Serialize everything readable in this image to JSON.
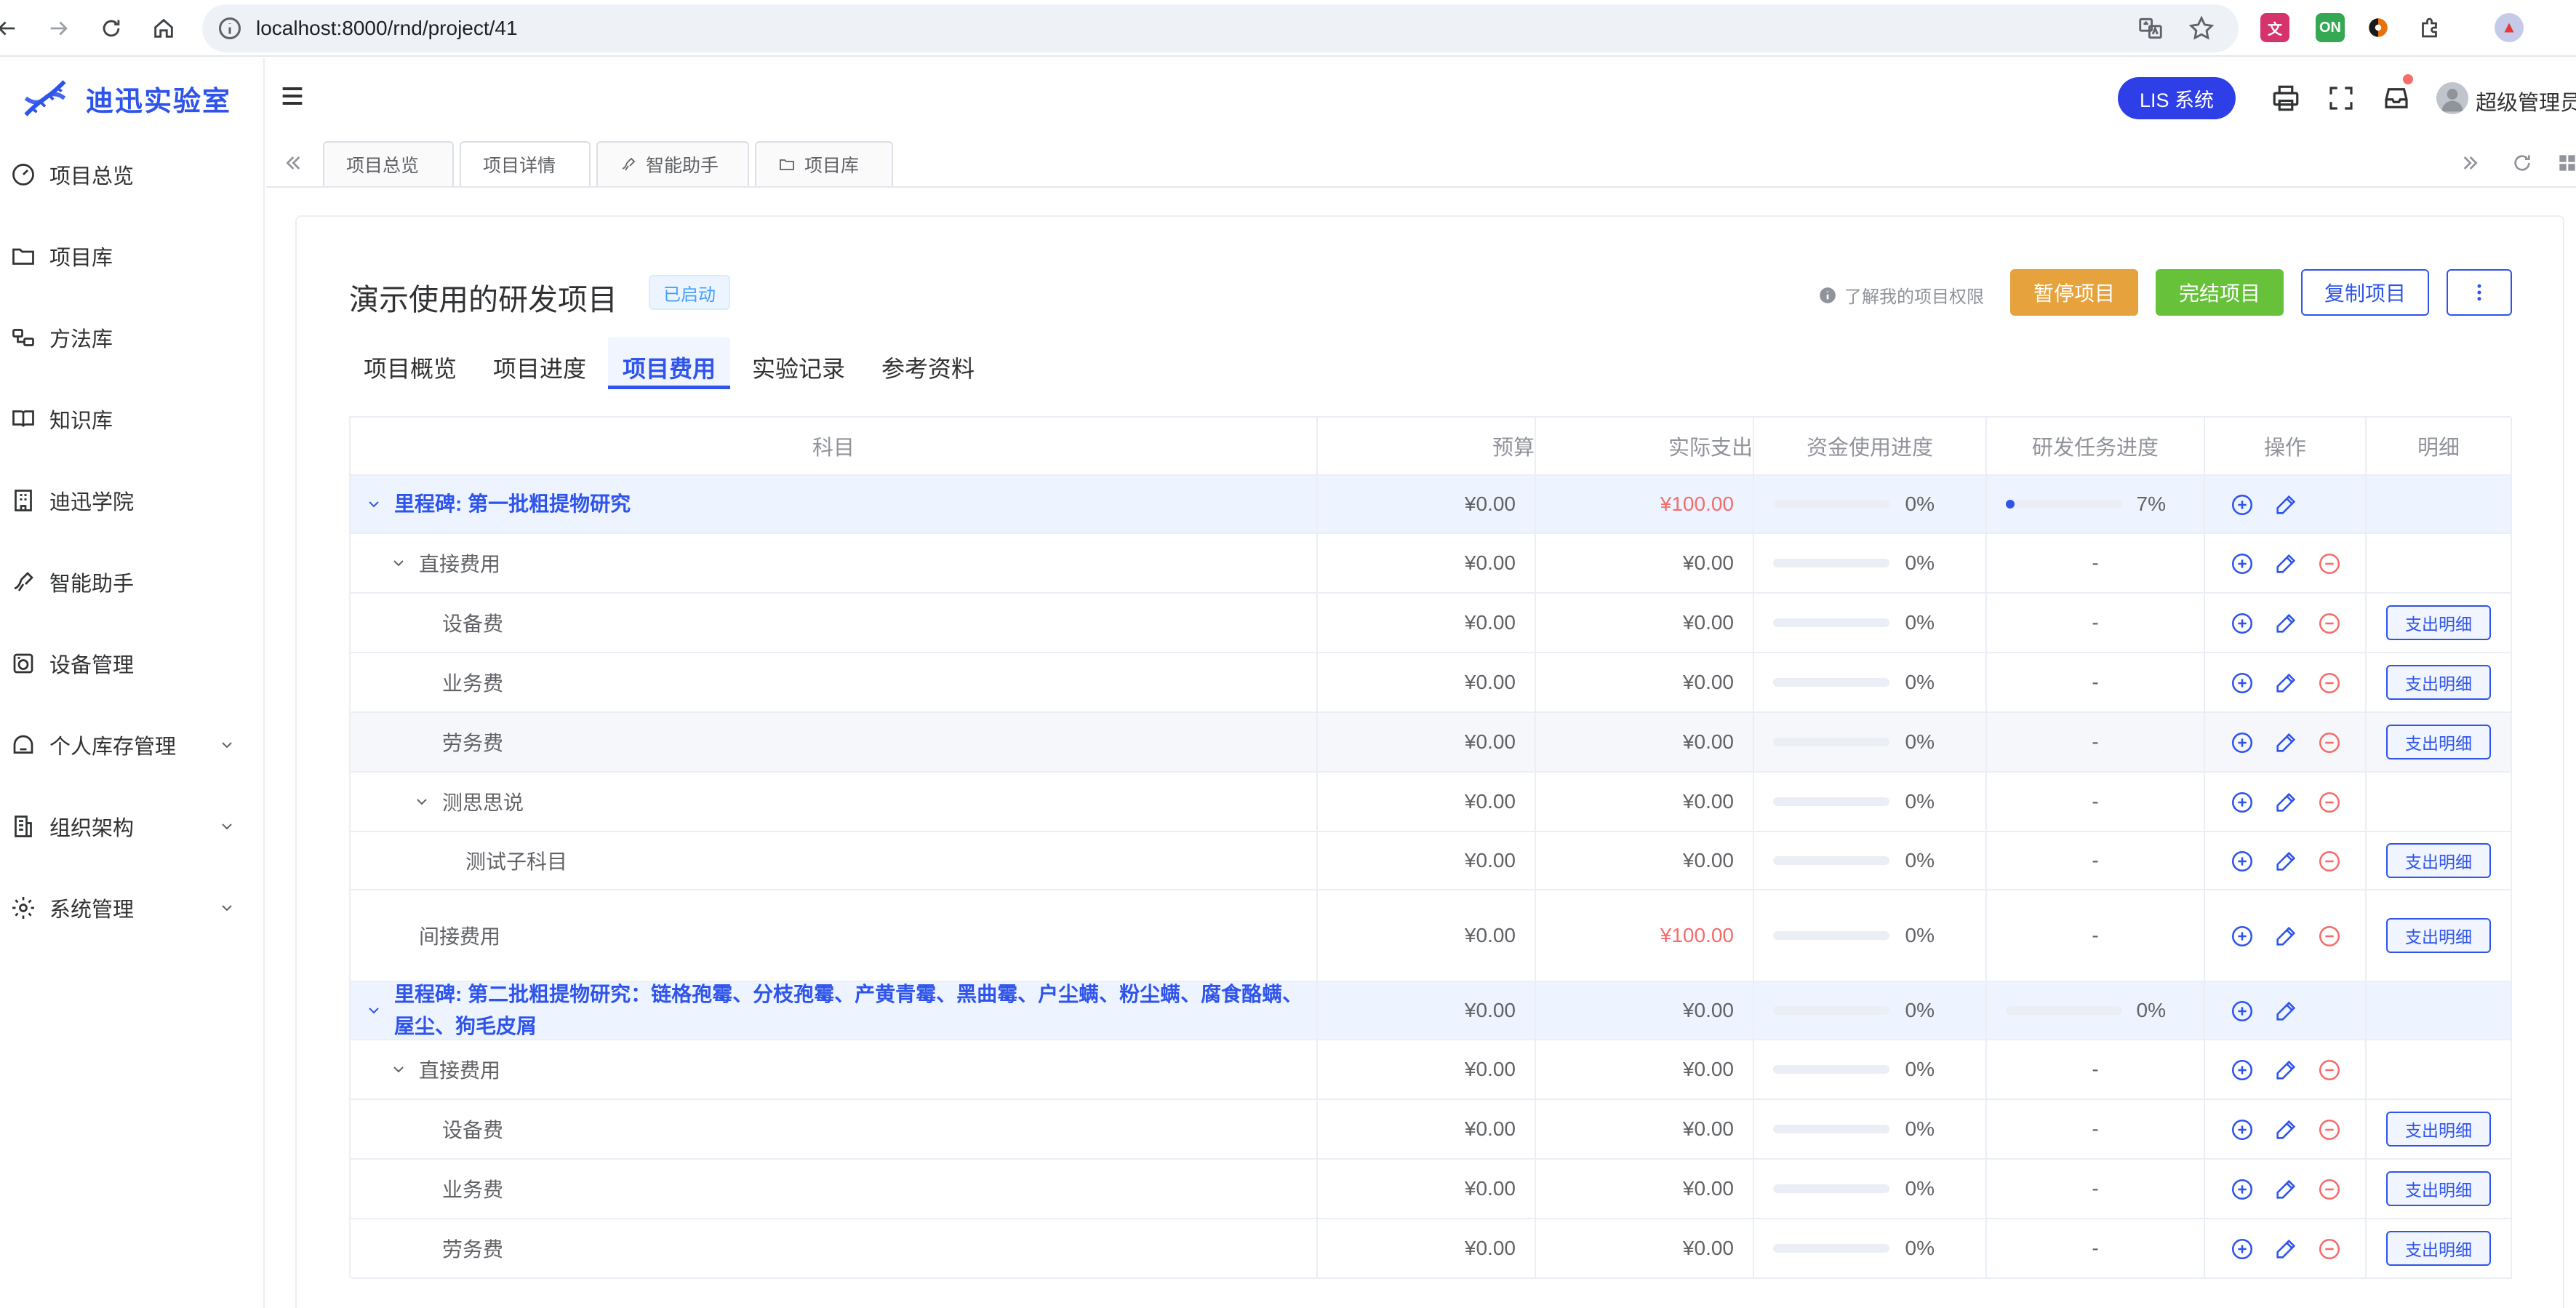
{
  "browser": {
    "url": "localhost:8000/rnd/project/41"
  },
  "app": {
    "logo_text": "迪迅实验室",
    "lis_button": "LIS 系统",
    "user_name": "超级管理员"
  },
  "sidebar": {
    "items": [
      {
        "label": "项目总览",
        "icon": "dashboard-icon",
        "expandable": false
      },
      {
        "label": "项目库",
        "icon": "folder-icon",
        "expandable": false
      },
      {
        "label": "方法库",
        "icon": "method-icon",
        "expandable": false
      },
      {
        "label": "知识库",
        "icon": "book-icon",
        "expandable": false
      },
      {
        "label": "迪迅学院",
        "icon": "building-icon",
        "expandable": false
      },
      {
        "label": "智能助手",
        "icon": "assistant-icon",
        "expandable": false
      },
      {
        "label": "设备管理",
        "icon": "device-icon",
        "expandable": false
      },
      {
        "label": "个人库存管理",
        "icon": "inventory-icon",
        "expandable": true
      },
      {
        "label": "组织架构",
        "icon": "org-icon",
        "expandable": true
      },
      {
        "label": "系统管理",
        "icon": "gear-icon",
        "expandable": true
      }
    ]
  },
  "page_tabs": [
    {
      "label": "项目总览",
      "icon": "",
      "active": false
    },
    {
      "label": "项目详情",
      "icon": "",
      "active": true
    },
    {
      "label": "智能助手",
      "icon": "assistant-icon",
      "active": false
    },
    {
      "label": "项目库",
      "icon": "folder-icon",
      "active": false
    }
  ],
  "project": {
    "title": "演示使用的研发项目",
    "status": "已启动",
    "permission_link": "了解我的项目权限",
    "buttons": {
      "pause": "暂停项目",
      "finish": "完结项目",
      "copy": "复制项目"
    },
    "sub_tabs": [
      {
        "label": "项目概览",
        "active": false
      },
      {
        "label": "项目进度",
        "active": false
      },
      {
        "label": "项目费用",
        "active": true
      },
      {
        "label": "实验记录",
        "active": false
      },
      {
        "label": "参考资料",
        "active": false
      }
    ]
  },
  "cost_table": {
    "headers": [
      "科目",
      "预算",
      "实际支出",
      "资金使用进度",
      "研发任务进度",
      "操作",
      "明细"
    ],
    "detail_button": "支出明细",
    "rows": [
      {
        "type": "milestone",
        "subject": "里程碑: 第一批粗提物研究",
        "budget": "¥0.00",
        "actual": "¥100.00",
        "actual_red": true,
        "fund_progress": 0,
        "fund_pct": "0%",
        "task_progress": 0.07,
        "task_pct": "7%",
        "has_delete": false,
        "has_detail": false,
        "alt": false
      },
      {
        "type": "group",
        "level": 1,
        "subject": "直接费用",
        "budget": "¥0.00",
        "actual": "¥0.00",
        "actual_red": false,
        "fund_progress": 0,
        "fund_pct": "0%",
        "task_pct": "-",
        "has_delete": true,
        "has_detail": false,
        "alt": false
      },
      {
        "type": "item",
        "level": 2,
        "subject": "设备费",
        "budget": "¥0.00",
        "actual": "¥0.00",
        "actual_red": false,
        "fund_progress": 0,
        "fund_pct": "0%",
        "task_pct": "-",
        "has_delete": true,
        "has_detail": true,
        "alt": false
      },
      {
        "type": "item",
        "level": 2,
        "subject": "业务费",
        "budget": "¥0.00",
        "actual": "¥0.00",
        "actual_red": false,
        "fund_progress": 0,
        "fund_pct": "0%",
        "task_pct": "-",
        "has_delete": true,
        "has_detail": true,
        "alt": false
      },
      {
        "type": "item",
        "level": 2,
        "subject": "劳务费",
        "budget": "¥0.00",
        "actual": "¥0.00",
        "actual_red": false,
        "fund_progress": 0,
        "fund_pct": "0%",
        "task_pct": "-",
        "has_delete": true,
        "has_detail": true,
        "alt": true
      },
      {
        "type": "group",
        "level": 2,
        "subject": "测思思说",
        "budget": "¥0.00",
        "actual": "¥0.00",
        "actual_red": false,
        "fund_progress": 0,
        "fund_pct": "0%",
        "task_pct": "-",
        "has_delete": true,
        "has_detail": false,
        "alt": false
      },
      {
        "type": "item",
        "level": 3,
        "subject": "测试子科目",
        "budget": "¥0.00",
        "actual": "¥0.00",
        "actual_red": false,
        "fund_progress": 0,
        "fund_pct": "0%",
        "task_pct": "-",
        "has_delete": true,
        "has_detail": true,
        "alt": false
      },
      {
        "type": "item",
        "level": 1,
        "subject": "间接费用",
        "budget": "¥0.00",
        "actual": "¥100.00",
        "actual_red": true,
        "fund_progress": 0,
        "fund_pct": "0%",
        "task_pct": "-",
        "has_delete": true,
        "has_detail": true,
        "alt": false
      },
      {
        "type": "milestone",
        "subject": "里程碑: 第二批粗提物研究：链格孢霉、分枝孢霉、产黄青霉、黑曲霉、户尘螨、粉尘螨、腐食酪螨、屋尘、狗毛皮屑",
        "budget": "¥0.00",
        "actual": "¥0.00",
        "actual_red": false,
        "fund_progress": 0,
        "fund_pct": "0%",
        "task_progress": 0,
        "task_pct": "0%",
        "has_delete": false,
        "has_detail": false,
        "alt": false
      },
      {
        "type": "group",
        "level": 1,
        "subject": "直接费用",
        "budget": "¥0.00",
        "actual": "¥0.00",
        "actual_red": false,
        "fund_progress": 0,
        "fund_pct": "0%",
        "task_pct": "-",
        "has_delete": true,
        "has_detail": false,
        "alt": false
      },
      {
        "type": "item",
        "level": 2,
        "subject": "设备费",
        "budget": "¥0.00",
        "actual": "¥0.00",
        "actual_red": false,
        "fund_progress": 0,
        "fund_pct": "0%",
        "task_pct": "-",
        "has_delete": true,
        "has_detail": true,
        "alt": false
      },
      {
        "type": "item",
        "level": 2,
        "subject": "业务费",
        "budget": "¥0.00",
        "actual": "¥0.00",
        "actual_red": false,
        "fund_progress": 0,
        "fund_pct": "0%",
        "task_pct": "-",
        "has_delete": true,
        "has_detail": true,
        "alt": false
      },
      {
        "type": "item",
        "level": 2,
        "subject": "劳务费",
        "budget": "¥0.00",
        "actual": "¥0.00",
        "actual_red": false,
        "fund_progress": 0,
        "fund_pct": "0%",
        "task_pct": "-",
        "has_delete": true,
        "has_detail": true,
        "alt": false
      }
    ]
  },
  "colors": {
    "primary": "#2f54eb",
    "lis_button": "#2f3fe8",
    "pause": "#e6a23c",
    "finish": "#67c23a",
    "danger": "#f56c6c",
    "milestone_row_bg": "#edf4ff"
  }
}
